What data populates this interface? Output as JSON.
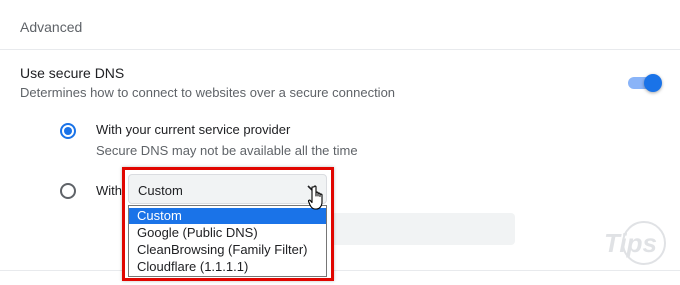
{
  "section": {
    "title": "Advanced"
  },
  "secure_dns": {
    "label": "Use secure DNS",
    "description": "Determines how to connect to websites over a secure connection",
    "enabled": true
  },
  "options": {
    "current_provider": {
      "label": "With your current service provider",
      "sub": "Secure DNS may not be available all the time",
      "checked": true
    },
    "custom_provider": {
      "label": "With",
      "checked": false
    }
  },
  "provider_select": {
    "value": "Custom",
    "options": [
      "Custom",
      "Google (Public DNS)",
      "CleanBrowsing (Family Filter)",
      "Cloudflare (1.1.1.1)"
    ],
    "selected_index": 0
  },
  "colors": {
    "accent": "#1a73e8",
    "highlight_frame": "#e10600"
  },
  "icons": {
    "cursor": "hand-pointer-icon",
    "watermark": "tips-logo-icon"
  }
}
